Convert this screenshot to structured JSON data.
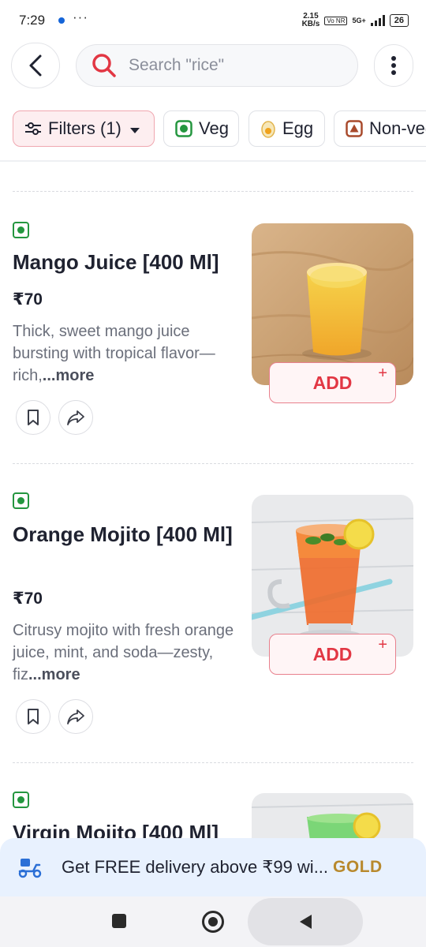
{
  "status_bar": {
    "time": "7:29",
    "more": "···",
    "speed_value": "2.15",
    "speed_unit": "KB/s",
    "volte": "Vo NR",
    "network": "5G+",
    "battery": "26"
  },
  "search": {
    "placeholder": "Search \"rice\""
  },
  "filters": {
    "filter_label": "Filters (1)",
    "veg_label": "Veg",
    "egg_label": "Egg",
    "nonveg_label": "Non-veg"
  },
  "items": [
    {
      "name": "Mango Juice [400 Ml]",
      "price": "₹70",
      "description": "Thick, sweet mango juice bursting with tropical flavor—rich,",
      "more": "...more",
      "add_label": "ADD",
      "add_plus": "+"
    },
    {
      "name": "Orange Mojito [400 Ml]",
      "price": "₹70",
      "description": "Citrusy mojito with fresh orange juice, mint, and soda—zesty, fiz",
      "more": "...more",
      "add_label": "ADD",
      "add_plus": "+"
    },
    {
      "name": "Virgin Mojito [400 Ml]"
    }
  ],
  "banner": {
    "text": "Get FREE delivery above ₹99 wi...",
    "gold": "GOLD"
  },
  "colors": {
    "brand_red": "#e23744",
    "veg_green": "#24963f",
    "gold": "#b8892d",
    "banner_bg": "#e8f1fe"
  }
}
